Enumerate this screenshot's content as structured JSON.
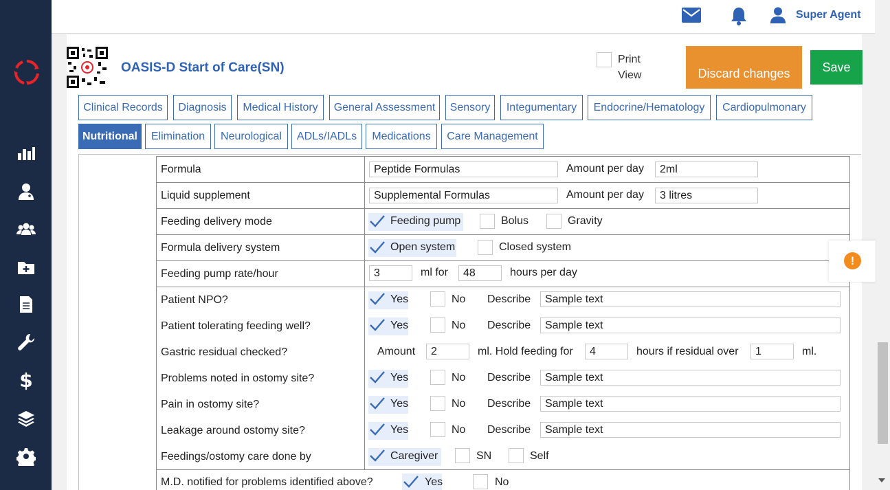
{
  "header": {
    "user_name": "Super Agent"
  },
  "page": {
    "title": "OASIS-D Start of Care(SN)",
    "print_view_label": "Print View",
    "discard_label": "Discard changes",
    "save_label": "Save"
  },
  "tabs_row1": [
    "Clinical Records",
    "Diagnosis",
    "Medical History",
    "General Assessment",
    "Sensory",
    "Integumentary",
    "Endocrine/Hematology",
    "Cardiopulmonary"
  ],
  "tabs_row2": [
    "Nutritional",
    "Elimination",
    "Neurological",
    "ADLs/IADLs",
    "Medications",
    "Care Management"
  ],
  "active_tab": "Nutritional",
  "form": {
    "formula": {
      "label": "Formula",
      "value": "Peptide Formulas",
      "amount_label": "Amount per day",
      "amount": "2ml"
    },
    "liquid_supplement": {
      "label": "Liquid supplement",
      "value": "Supplemental Formulas",
      "amount_label": "Amount per day",
      "amount": "3 litres"
    },
    "feeding_delivery_mode": {
      "label": "Feeding delivery mode",
      "options": [
        "Feeding pump",
        "Bolus",
        "Gravity"
      ],
      "selected": "Feeding pump"
    },
    "formula_delivery_system": {
      "label": "Formula delivery system",
      "options": [
        "Open system",
        "Closed system"
      ],
      "selected": "Open system"
    },
    "feeding_pump_rate": {
      "label": "Feeding pump rate/hour",
      "rate": "3",
      "ml_for": "ml for",
      "hours": "48",
      "hours_label": "hours per day"
    },
    "patient_npo": {
      "label": "Patient NPO?",
      "yes": "Yes",
      "no": "No",
      "selected": "Yes",
      "describe_label": "Describe",
      "describe": "Sample text"
    },
    "tolerating": {
      "label": "Patient tolerating feeding well?",
      "yes": "Yes",
      "no": "No",
      "selected": "Yes",
      "describe_label": "Describe",
      "describe": "Sample text"
    },
    "gastric": {
      "label": "Gastric residual checked?",
      "amount_label": "Amount",
      "amount": "2",
      "hold_label": "ml. Hold feeding for",
      "hold": "4",
      "residual_label": "hours if residual over",
      "residual": "1",
      "ml_label": "ml."
    },
    "ostomy_problems": {
      "label": "Problems noted in ostomy site?",
      "yes": "Yes",
      "no": "No",
      "selected": "Yes",
      "describe_label": "Describe",
      "describe": "Sample text"
    },
    "ostomy_pain": {
      "label": "Pain in ostomy site?",
      "yes": "Yes",
      "no": "No",
      "selected": "Yes",
      "describe_label": "Describe",
      "describe": "Sample text"
    },
    "ostomy_leakage": {
      "label": "Leakage around ostomy site?",
      "yes": "Yes",
      "no": "No",
      "selected": "Yes",
      "describe_label": "Describe",
      "describe": "Sample text"
    },
    "care_done_by": {
      "label": "Feedings/ostomy care done by",
      "options": [
        "Caregiver",
        "SN",
        "Self"
      ],
      "selected": "Caregiver"
    },
    "md_notified": {
      "label": "M.D. notified for problems identified above?",
      "yes": "Yes",
      "no": "No",
      "selected": "Yes"
    }
  },
  "alert": {
    "symbol": "!"
  },
  "colors": {
    "sidebar": "#1c2b45",
    "accent": "#2f62b5",
    "discard": "#e8912e",
    "save": "#16a34a",
    "alert": "#f28c1e"
  }
}
